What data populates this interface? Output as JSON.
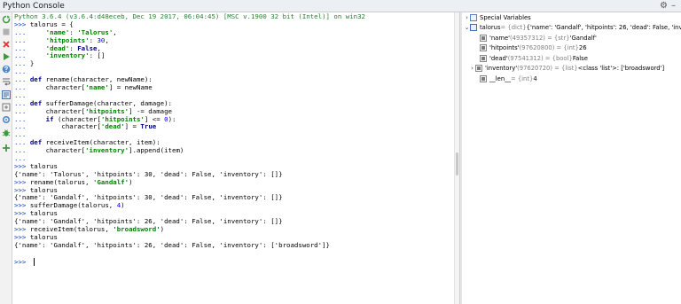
{
  "window": {
    "title": "Python Console",
    "controls": [
      "⚙",
      "–"
    ]
  },
  "toolbar": {
    "icons": [
      "rerun-icon",
      "stop-icon",
      "close-icon",
      "run-icon",
      "help-icon",
      "soft-wrap-icon",
      "show-variables-icon",
      "attach-debugger-icon",
      "settings-icon",
      "bug-icon",
      "add-icon"
    ]
  },
  "console": {
    "header": "Python 3.6.4 (v3.6.4:d48eceb, Dec 19 2017, 06:04:45) [MSC v.1900 32 bit (Intel)] on win32",
    "lines": [
      ">>> talorus = {",
      "...     'name': 'Talorus',",
      "...     'hitpoints': 30,",
      "...     'dead': False,",
      "...     'inventory': []",
      "... }",
      "...",
      "... def rename(character, newName):",
      "...     character['name'] = newName",
      "...",
      "... def sufferDamage(character, damage):",
      "...     character['hitpoints'] -= damage",
      "...     if (character['hitpoints'] <= 0):",
      "...         character['dead'] = True",
      "...",
      "... def receiveItem(character, item):",
      "...     character['inventory'].append(item)",
      "...",
      ">>> talorus",
      "{'name': 'Talorus', 'hitpoints': 30, 'dead': False, 'inventory': []}",
      ">>> rename(talorus, 'Gandalf')",
      ">>> talorus",
      "{'name': 'Gandalf', 'hitpoints': 30, 'dead': False, 'inventory': []}",
      ">>> sufferDamage(talorus, 4)",
      ">>> talorus",
      "{'name': 'Gandalf', 'hitpoints': 26, 'dead': False, 'inventory': []}",
      ">>> receiveItem(talorus, 'broadsword')",
      ">>> talorus",
      "{'name': 'Gandalf', 'hitpoints': 26, 'dead': False, 'inventory': ['broadsword']}",
      "",
      ">>> "
    ]
  },
  "variables": {
    "special": "Special Variables",
    "talorus": {
      "name": "talorus",
      "meta": " = {dict} ",
      "value": "{'name': 'Gandalf', 'hitpoints': 26, 'dead': False, 'inven"
    },
    "children": [
      {
        "name": "'name'",
        "meta": " (49357312) = {str} ",
        "value": "'Gandalf'"
      },
      {
        "name": "'hitpoints'",
        "meta": " (97620800) = {int} ",
        "value": "26"
      },
      {
        "name": "'dead'",
        "meta": " (97541312) = {bool} ",
        "value": "False"
      },
      {
        "name": "'inventory'",
        "meta": " (97620720) = {list} ",
        "value": "<class 'list'>: ['broadsword']"
      },
      {
        "name": "__len__",
        "meta": " = {int} ",
        "value": "4"
      }
    ]
  }
}
